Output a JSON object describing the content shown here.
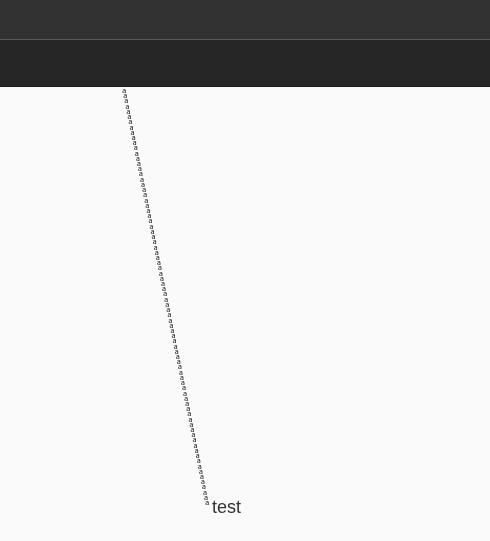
{
  "trail": {
    "glyph": "a",
    "glyph_count": 80
  },
  "text_label": {
    "text": "test"
  },
  "colors": {
    "titlebar": "#323232",
    "toolbar": "#262626",
    "canvas_background": "#fafafa",
    "text": "#333333"
  }
}
